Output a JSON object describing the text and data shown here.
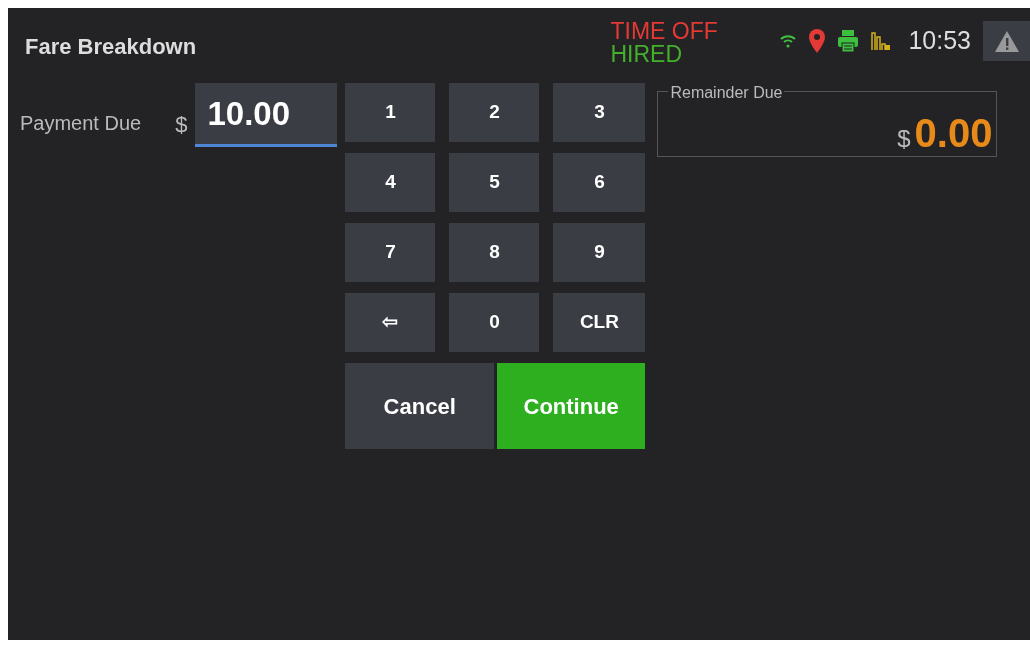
{
  "header": {
    "title": "Fare Breakdown",
    "status_lines": [
      {
        "text": "TIME OFF",
        "color": "#e53935"
      },
      {
        "text": "HIRED",
        "color": "#43b02a"
      }
    ],
    "time": "10:53"
  },
  "payment": {
    "label": "Payment Due",
    "currency": "$",
    "value": "10.00"
  },
  "keypad": [
    "1",
    "2",
    "3",
    "4",
    "5",
    "6",
    "7",
    "8",
    "9",
    "⇦",
    "0",
    "CLR"
  ],
  "actions": [
    {
      "label": "Cancel",
      "kind": "secondary"
    },
    {
      "label": "Continue",
      "kind": "primary"
    }
  ],
  "remainder": {
    "legend": "Remainder Due",
    "currency": "$",
    "value": "0.00"
  }
}
